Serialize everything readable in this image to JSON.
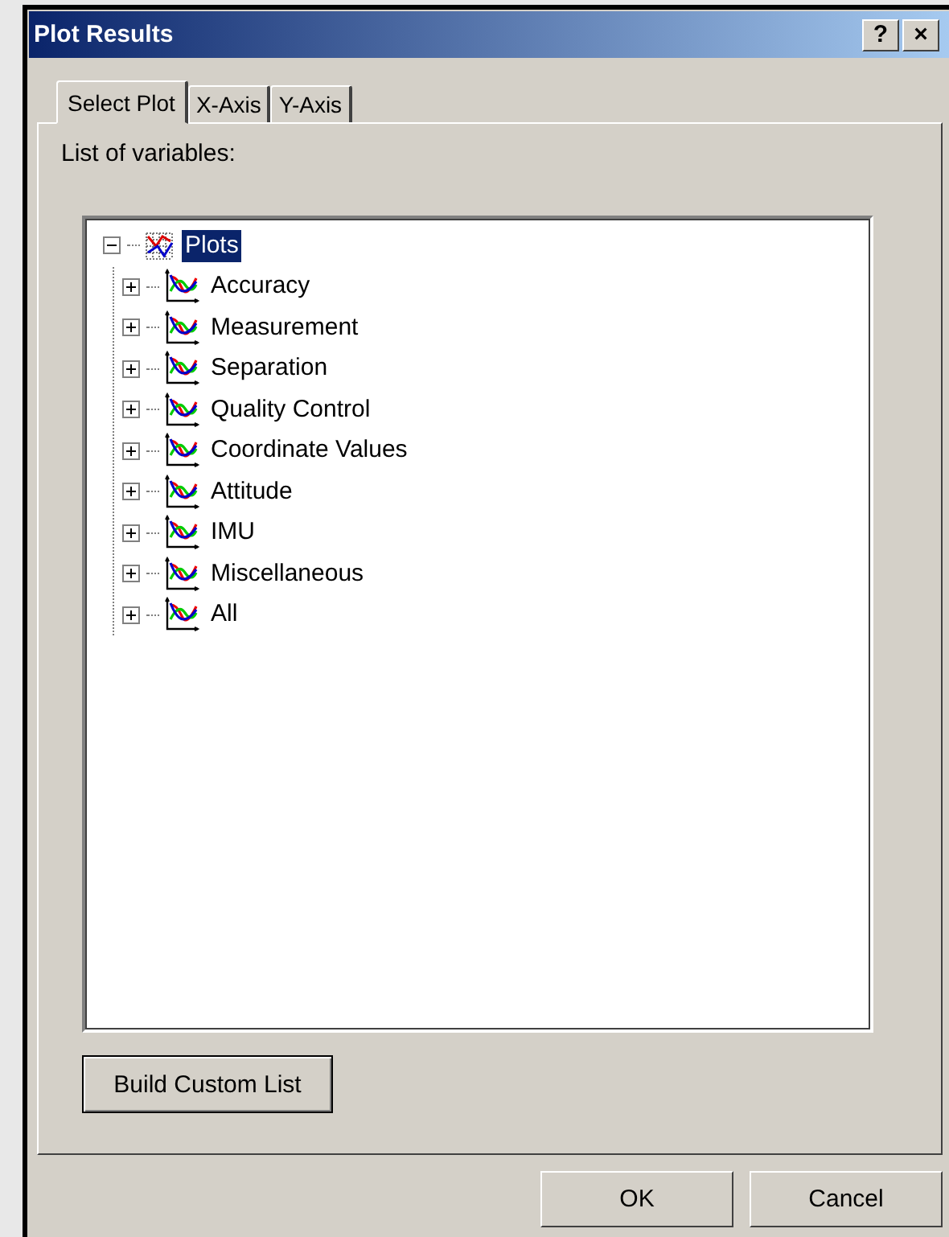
{
  "window": {
    "title": "Plot Results",
    "title_buttons": [
      "?",
      "×"
    ]
  },
  "tabs": [
    {
      "label": "Select Plot",
      "selected": true
    },
    {
      "label": "X-Axis",
      "selected": false
    },
    {
      "label": "Y-Axis",
      "selected": false
    }
  ],
  "list_label": "List of variables:",
  "tree": [
    {
      "label": "Plots",
      "kind": "root",
      "expanded": true,
      "selected": true,
      "children": [
        {
          "label": "Accuracy",
          "kind": "plot",
          "expanded": false,
          "selected": false
        },
        {
          "label": "Measurement",
          "kind": "plot",
          "expanded": false,
          "selected": false
        },
        {
          "label": "Separation",
          "kind": "plot",
          "expanded": false,
          "selected": false
        },
        {
          "label": "Quality Control",
          "kind": "plot",
          "expanded": false,
          "selected": false
        },
        {
          "label": "Coordinate Values",
          "kind": "plot",
          "expanded": false,
          "selected": false
        },
        {
          "label": "Attitude",
          "kind": "plot",
          "expanded": false,
          "selected": false
        },
        {
          "label": "IMU",
          "kind": "plot",
          "expanded": false,
          "selected": false
        },
        {
          "label": "Miscellaneous",
          "kind": "plot",
          "expanded": false,
          "selected": false
        },
        {
          "label": "All",
          "kind": "plot",
          "expanded": false,
          "selected": false
        }
      ]
    }
  ],
  "build_button": "Build Custom List",
  "buttons": [
    "OK",
    "Cancel"
  ]
}
